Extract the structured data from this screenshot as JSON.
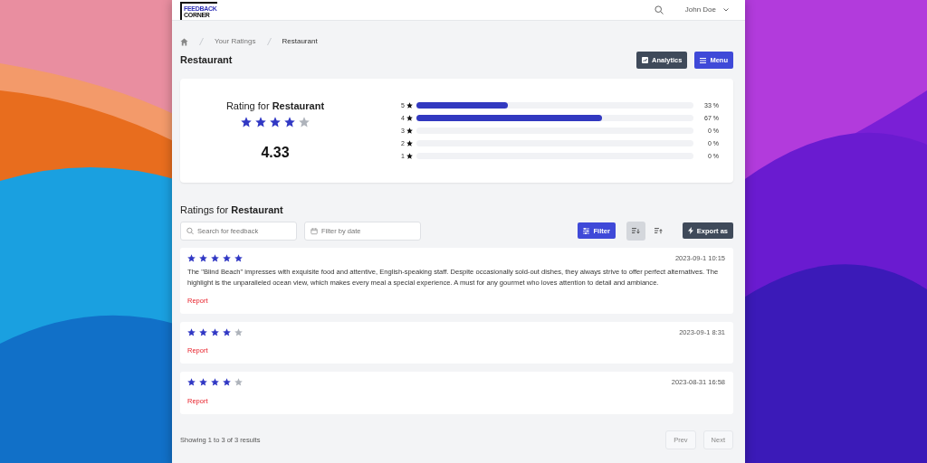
{
  "header": {
    "logo": [
      "FEEDBACK",
      "CORNER"
    ],
    "user": "John Doe"
  },
  "breadcrumb": [
    "Your Ratings",
    "Restaurant"
  ],
  "page_title": "Restaurant",
  "actions": [
    {
      "label": "Analytics",
      "kind": "dark"
    },
    {
      "label": "Menu",
      "kind": "primary"
    }
  ],
  "summary": {
    "heading": "Rating for **Restaurant**",
    "stars": 4,
    "average": "4.33",
    "bars": [
      {
        "label": "5",
        "level": 0.33,
        "reading": "33 %"
      },
      {
        "label": "4",
        "level": 0.67,
        "reading": "67 %"
      },
      {
        "label": "3",
        "level": 0,
        "reading": "0 %"
      },
      {
        "label": "2",
        "level": 0,
        "reading": "0 %"
      },
      {
        "label": "1",
        "level": 0,
        "reading": "0 %"
      }
    ]
  },
  "ratings_heading": "Ratings for **Restaurant**",
  "search": {
    "placeholder": "Search for feedback"
  },
  "date_filter": {
    "placeholder": "Filter by date"
  },
  "filter_button": "Filter",
  "sort_buttons": [
    {
      "kind": "descending",
      "selected": true
    },
    {
      "kind": "ascending",
      "selected": false
    }
  ],
  "export_button": "Export as",
  "reviews": [
    {
      "stars": 5,
      "date": "2023-09-1 10:15",
      "text": "The \"Blind Beach\" impresses with exquisite food and attentive, English-speaking staff. Despite occasionally sold-out dishes, they always strive to offer perfect alternatives. The highlight is the unparalleled ocean view, which makes every meal a special experience. A must for any gourmet who loves attention to detail and ambiance.",
      "report": "Report"
    },
    {
      "stars": 4,
      "date": "2023-09-1 8:31",
      "report": "Report"
    },
    {
      "stars": 4,
      "date": "2023-08-31 16:58",
      "report": "Report"
    }
  ],
  "footer": {
    "summary": "Showing 1 to 3 of 3 results",
    "pages": [
      "Prev",
      "Next"
    ]
  }
}
